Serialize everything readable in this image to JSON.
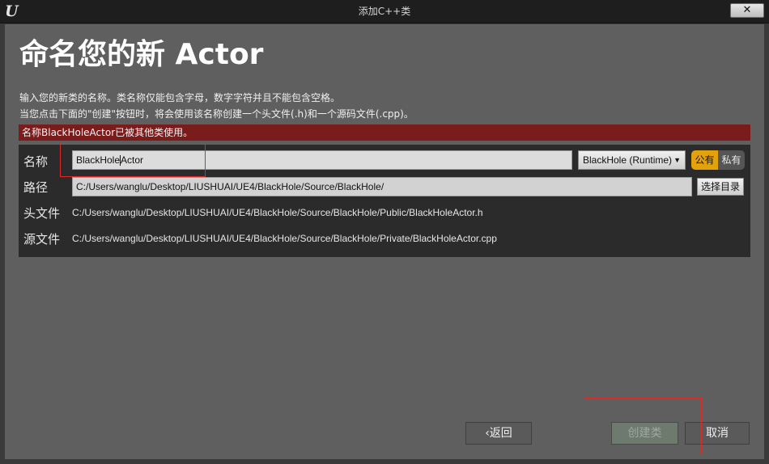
{
  "window": {
    "title": "添加C++类",
    "close_label": "✕"
  },
  "heading": "命名您的新 Actor",
  "description": {
    "line1": "输入您的新类的名称。类名称仅能包含字母，数字字符并且不能包含空格。",
    "line2": "当您点击下面的\"创建\"按钮时，将会使用该名称创建一个头文件(.h)和一个源码文件(.cpp)。"
  },
  "error_message": "名称BlackHoleActor已被其他类使用。",
  "form": {
    "name_label": "名称",
    "name_value_before_caret": "BlackHole",
    "name_value_after_caret": "Actor",
    "module_select": "BlackHole (Runtime)",
    "visibility": {
      "public_label": "公有",
      "private_label": "私有",
      "selected": "公有"
    },
    "path_label": "路径",
    "path_value": "C:/Users/wanglu/Desktop/LIUSHUAI/UE4/BlackHole/Source/BlackHole/",
    "choose_dir_label": "选择目录",
    "header_label": "头文件",
    "header_value": "C:/Users/wanglu/Desktop/LIUSHUAI/UE4/BlackHole/Source/BlackHole/Public/BlackHoleActor.h",
    "source_label": "源文件",
    "source_value": "C:/Users/wanglu/Desktop/LIUSHUAI/UE4/BlackHole/Source/BlackHole/Private/BlackHoleActor.cpp"
  },
  "buttons": {
    "back": "‹返回",
    "create": "创建类",
    "cancel": "取消"
  },
  "colors": {
    "error_bar": "#7a1c1c",
    "public_toggle": "#e3a20c",
    "annotation_box": "#e02a2a"
  }
}
